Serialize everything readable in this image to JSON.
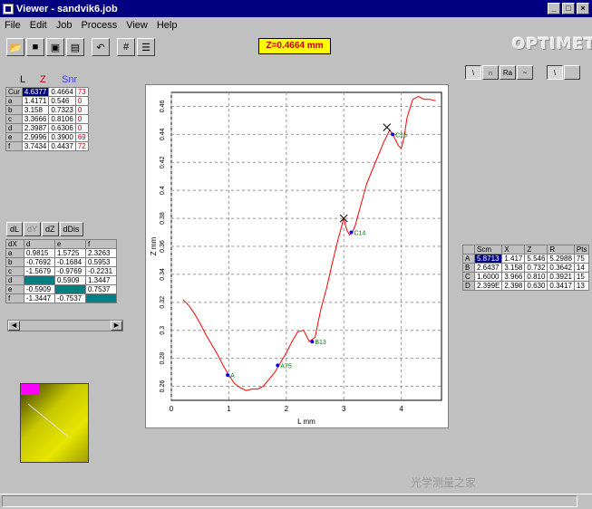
{
  "window": {
    "title": "Viewer - sandvik6.job",
    "min": "_",
    "max": "□",
    "close": "×"
  },
  "menu": [
    "File",
    "Edit",
    "Job",
    "Process",
    "View",
    "Help"
  ],
  "toolbar": {
    "icons": [
      "open-icon",
      "save-icon",
      "archive-icon",
      "print-icon",
      "undo-icon",
      "grid-icon",
      "table-icon"
    ]
  },
  "zvalue": "Z=0.4664 mm",
  "brand": "OPTIMET",
  "modes": [
    "\\",
    "∩",
    "Ra",
    "~",
    "\\",
    ""
  ],
  "cursor_table": {
    "headers": [
      "L",
      "Z",
      "Snr"
    ],
    "rows": [
      [
        "Cur",
        "4.6377",
        "0.4664",
        "73"
      ],
      [
        "a",
        "1.4171",
        "0.546",
        "0"
      ],
      [
        "b",
        "3.158",
        "0.7323",
        "0"
      ],
      [
        "c",
        "3.3666",
        "0.8106",
        "0"
      ],
      [
        "d",
        "2.3987",
        "0.6306",
        "0"
      ],
      [
        "e",
        "2.9996",
        "0.3900",
        "69"
      ],
      [
        "f",
        "3.7434",
        "0.4437",
        "72"
      ]
    ]
  },
  "tabs": [
    "dL",
    "dY",
    "dZ",
    "dDis"
  ],
  "dist_table": {
    "headers": [
      "dX",
      "d",
      "e",
      "f"
    ],
    "rows": [
      [
        "a",
        "0.9815",
        "1.5725",
        "2.3263"
      ],
      [
        "b",
        "-0.7692",
        "-0.1684",
        "0.5953"
      ],
      [
        "c",
        "-1.5679",
        "-0.9769",
        "-0.2231"
      ],
      [
        "d",
        "",
        "0.5909",
        "1.3447"
      ],
      [
        "e",
        "-0.5909",
        "",
        "0.7537"
      ],
      [
        "f",
        "-1.3447",
        "-0.7537",
        ""
      ]
    ]
  },
  "segment_table": {
    "headers": [
      "",
      "Scm",
      "X",
      "Z",
      "R",
      "Pts"
    ],
    "rows": [
      [
        "A",
        "5.8713",
        "1.417",
        "5.546",
        "5.2988",
        "75"
      ],
      [
        "B",
        "2.6437",
        "3.158",
        "0.732",
        "0.3642",
        "14"
      ],
      [
        "C",
        "1.6000",
        "3.966",
        "0.810",
        "0.3921",
        "15"
      ],
      [
        "D",
        "2.399E",
        "2.398",
        "0.630",
        "0.3417",
        "13"
      ]
    ]
  },
  "watermark": "光学测量之家",
  "chart_data": {
    "type": "line",
    "xlabel": "L mm",
    "ylabel": "Z mm",
    "xlim": [
      0,
      4.7
    ],
    "ylim": [
      0.25,
      0.47
    ],
    "xticks": [
      "0",
      "1",
      "2",
      "3",
      "4"
    ],
    "yticks": [
      "0.26",
      "0.28",
      "0.3",
      "0.32",
      "0.34",
      "0.36",
      "0.38",
      "0.4",
      "0.42",
      "0.44",
      "0.46"
    ],
    "grid": true,
    "series": [
      {
        "color": "#ff0000",
        "x": [
          0.2,
          0.3,
          0.4,
          0.5,
          0.6,
          0.7,
          0.8,
          0.9,
          1.0,
          1.1,
          1.2,
          1.3,
          1.4,
          1.5,
          1.6,
          1.7,
          1.8,
          1.9,
          2.0,
          2.1,
          2.2,
          2.3,
          2.4,
          2.5,
          2.6,
          2.7,
          2.8,
          2.9,
          3.0,
          3.05,
          3.1,
          3.15,
          3.2,
          3.3,
          3.4,
          3.5,
          3.6,
          3.7,
          3.8,
          3.85,
          3.9,
          3.95,
          4.0,
          4.05,
          4.1,
          4.2,
          4.3,
          4.4,
          4.5,
          4.6
        ],
        "y": [
          0.322,
          0.318,
          0.312,
          0.305,
          0.297,
          0.29,
          0.283,
          0.275,
          0.268,
          0.262,
          0.259,
          0.257,
          0.258,
          0.258,
          0.26,
          0.265,
          0.27,
          0.277,
          0.284,
          0.292,
          0.299,
          0.3,
          0.292,
          0.295,
          0.315,
          0.33,
          0.348,
          0.365,
          0.38,
          0.372,
          0.368,
          0.37,
          0.375,
          0.39,
          0.405,
          0.415,
          0.425,
          0.435,
          0.443,
          0.44,
          0.436,
          0.432,
          0.43,
          0.438,
          0.452,
          0.465,
          0.467,
          0.465,
          0.465,
          0.464
        ]
      }
    ],
    "markers": [
      {
        "x": 0.98,
        "y": 0.268,
        "label": "A"
      },
      {
        "x": 1.85,
        "y": 0.275,
        "label": "A75"
      },
      {
        "x": 2.45,
        "y": 0.292,
        "label": "B13"
      },
      {
        "x": 3.13,
        "y": 0.37,
        "label": "C14"
      },
      {
        "x": 3.85,
        "y": 0.44,
        "label": "C15"
      }
    ],
    "crosses": [
      {
        "x": 3.0,
        "y": 0.38
      },
      {
        "x": 3.75,
        "y": 0.445
      }
    ]
  }
}
